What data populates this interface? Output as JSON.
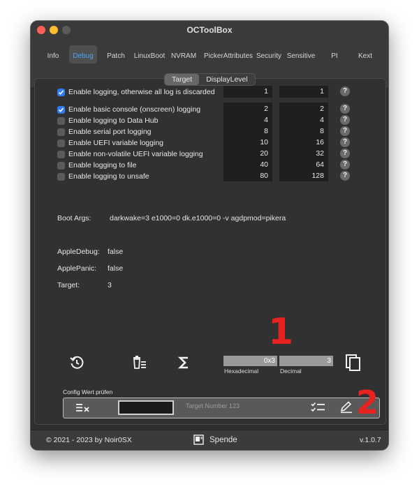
{
  "window": {
    "title": "OCToolBox"
  },
  "tabs": [
    {
      "label": "Info"
    },
    {
      "label": "Debug"
    },
    {
      "label": "Patch"
    },
    {
      "label": "LinuxBoot"
    },
    {
      "label": "NVRAM"
    },
    {
      "label": "PickerAttributes"
    },
    {
      "label": "Security"
    },
    {
      "label": "Sensitive"
    },
    {
      "label": "PI"
    },
    {
      "label": "Kext"
    }
  ],
  "segmented": {
    "target": "Target",
    "display_level": "DisplayLevel"
  },
  "first_option": {
    "label": "Enable logging, otherwise all log is discarded",
    "checked": true,
    "value_left": "1",
    "value_right": "1"
  },
  "options": [
    {
      "label": "Enable basic console (onscreen) logging",
      "checked": true,
      "target": "2",
      "display": "2"
    },
    {
      "label": "Enable logging to Data Hub",
      "checked": false,
      "target": "4",
      "display": "4"
    },
    {
      "label": "Enable serial port logging",
      "checked": false,
      "target": "8",
      "display": "8"
    },
    {
      "label": "Enable UEFI variable logging",
      "checked": false,
      "target": "10",
      "display": "16"
    },
    {
      "label": "Enable non-volatile UEFI variable logging",
      "checked": false,
      "target": "20",
      "display": "32"
    },
    {
      "label": "Enable logging to file",
      "checked": false,
      "target": "40",
      "display": "64"
    },
    {
      "label": "Enable logging to unsafe",
      "checked": false,
      "target": "80",
      "display": "128"
    }
  ],
  "help_glyph": "?",
  "boot_args": {
    "label": "Boot Args:",
    "value": "darkwake=3 e1000=0 dk.e1000=0 -v agdpmod=pikera"
  },
  "info": {
    "apple_debug_label": "AppleDebug:",
    "apple_debug_value": "false",
    "apple_panic_label": "ApplePanic:",
    "apple_panic_value": "false",
    "target_label": "Target:",
    "target_value": "3"
  },
  "bottom": {
    "hex_value": "0x3",
    "dec_value": "3",
    "hex_label": "Hexadecimal",
    "dec_label": "Decimal",
    "annotation_1": "1",
    "annotation_2": "2",
    "reset_icon": "reset-icon",
    "trash_icon": "trash-icon",
    "sum_icon": "sigma-icon",
    "copy_icon": "copy-icon"
  },
  "config_check": {
    "title": "Config Wert prüfen",
    "input_value": "",
    "placeholder": "Target Number 123"
  },
  "footer": {
    "copyright": "©  2021 - 2023 by Noir0SX",
    "donate": "Spende",
    "version": "v.1.0.7"
  },
  "colors": {
    "accent": "#4aa3ff",
    "checkbox": "#2f7cf6",
    "annotation": "#e8221f"
  }
}
